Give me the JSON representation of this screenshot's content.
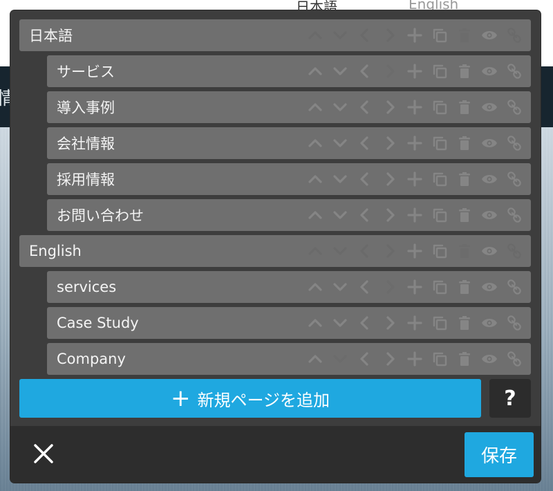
{
  "background": {
    "lang_ja": "日本語",
    "lang_en": "English",
    "nav_fragment": "情"
  },
  "tree": [
    {
      "type": "lang",
      "label": "日本語",
      "disabled": [
        "move-up",
        "move-down",
        "outdent",
        "indent",
        "delete",
        "link"
      ]
    },
    {
      "type": "page",
      "label": "サービス",
      "disabled": [
        "indent"
      ]
    },
    {
      "type": "page",
      "label": "導入事例",
      "disabled": []
    },
    {
      "type": "page",
      "label": "会社情報",
      "disabled": []
    },
    {
      "type": "page",
      "label": "採用情報",
      "disabled": []
    },
    {
      "type": "page",
      "label": "お問い合わせ",
      "disabled": []
    },
    {
      "type": "lang",
      "label": "English",
      "disabled": [
        "move-up",
        "move-down",
        "outdent",
        "indent",
        "delete",
        "link"
      ]
    },
    {
      "type": "page",
      "label": "services",
      "disabled": [
        "indent"
      ]
    },
    {
      "type": "page",
      "label": "Case Study",
      "disabled": []
    },
    {
      "type": "page",
      "label": "Company",
      "disabled": [
        "move-down"
      ]
    }
  ],
  "actions": [
    {
      "id": "move-up",
      "icon": "chevron-up-icon"
    },
    {
      "id": "move-down",
      "icon": "chevron-down-icon"
    },
    {
      "id": "outdent",
      "icon": "chevron-left-icon"
    },
    {
      "id": "indent",
      "icon": "chevron-right-icon"
    },
    {
      "id": "add",
      "icon": "plus-icon"
    },
    {
      "id": "duplicate",
      "icon": "copy-icon"
    },
    {
      "id": "delete",
      "icon": "trash-icon"
    },
    {
      "id": "visibility",
      "icon": "eye-icon"
    },
    {
      "id": "link",
      "icon": "link-icon"
    }
  ],
  "add_page_button": {
    "label": "新規ページを追加",
    "icon": "plus-icon"
  },
  "help_button": {
    "label": "?"
  },
  "footer": {
    "close_icon": "close-icon",
    "save_label": "保存"
  },
  "colors": {
    "accent": "#1fa8e0",
    "modal_bg": "#3d3d3d",
    "row_bg": "#6f6f6f",
    "footer_bg": "#2d2d2d",
    "icon": "#858585"
  }
}
